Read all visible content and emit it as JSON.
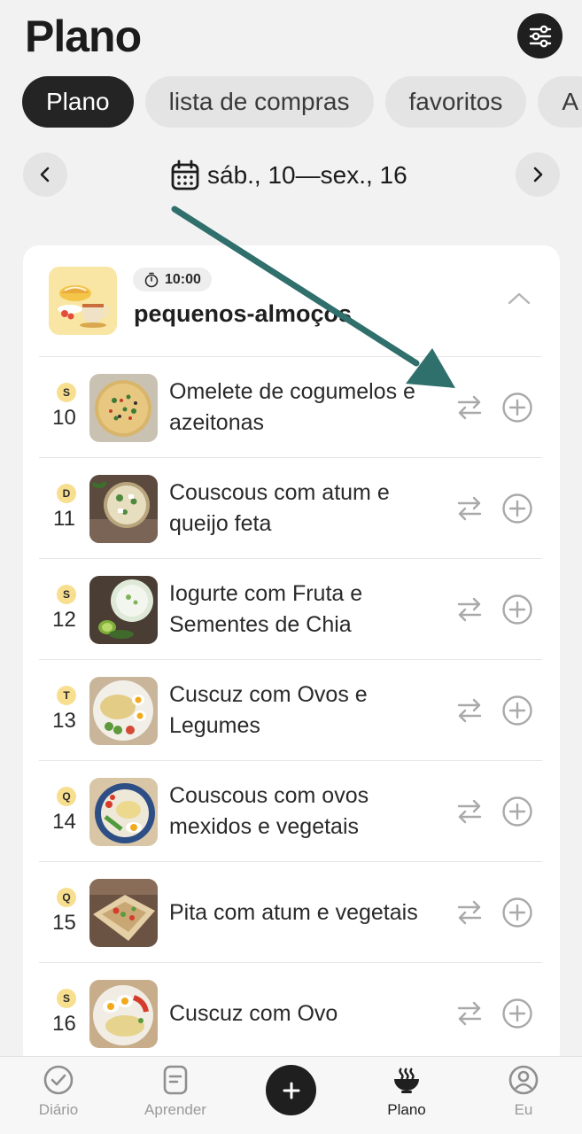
{
  "header": {
    "title": "Plano"
  },
  "tabs": [
    {
      "label": "Plano",
      "active": true
    },
    {
      "label": "lista de compras",
      "active": false
    },
    {
      "label": "favoritos",
      "active": false
    },
    {
      "label": "A",
      "active": false
    }
  ],
  "date_nav": {
    "range": "sáb., 10—sex., 16"
  },
  "meal": {
    "time": "10:00",
    "name": "pequenos-almoços"
  },
  "recipes": [
    {
      "day_letter": "S",
      "day_number": "10",
      "name": "Omelete de cogumelos e azeitonas"
    },
    {
      "day_letter": "D",
      "day_number": "11",
      "name": "Couscous com atum e queijo feta"
    },
    {
      "day_letter": "S",
      "day_number": "12",
      "name": "Iogurte com Fruta e Sementes de Chia"
    },
    {
      "day_letter": "T",
      "day_number": "13",
      "name": "Cuscuz com Ovos e Legumes"
    },
    {
      "day_letter": "Q",
      "day_number": "14",
      "name": "Couscous com ovos mexidos e vegetais"
    },
    {
      "day_letter": "Q",
      "day_number": "15",
      "name": "Pita com atum e vegetais"
    },
    {
      "day_letter": "S",
      "day_number": "16",
      "name": "Cuscuz com Ovo"
    }
  ],
  "bottom_nav": {
    "diario": "Diário",
    "aprender": "Aprender",
    "plano": "Plano",
    "eu": "Eu"
  },
  "colors": {
    "accent_dark": "#1f1f1f",
    "badge_yellow": "#f7df8f",
    "annotation_arrow": "#2f6f6c"
  }
}
